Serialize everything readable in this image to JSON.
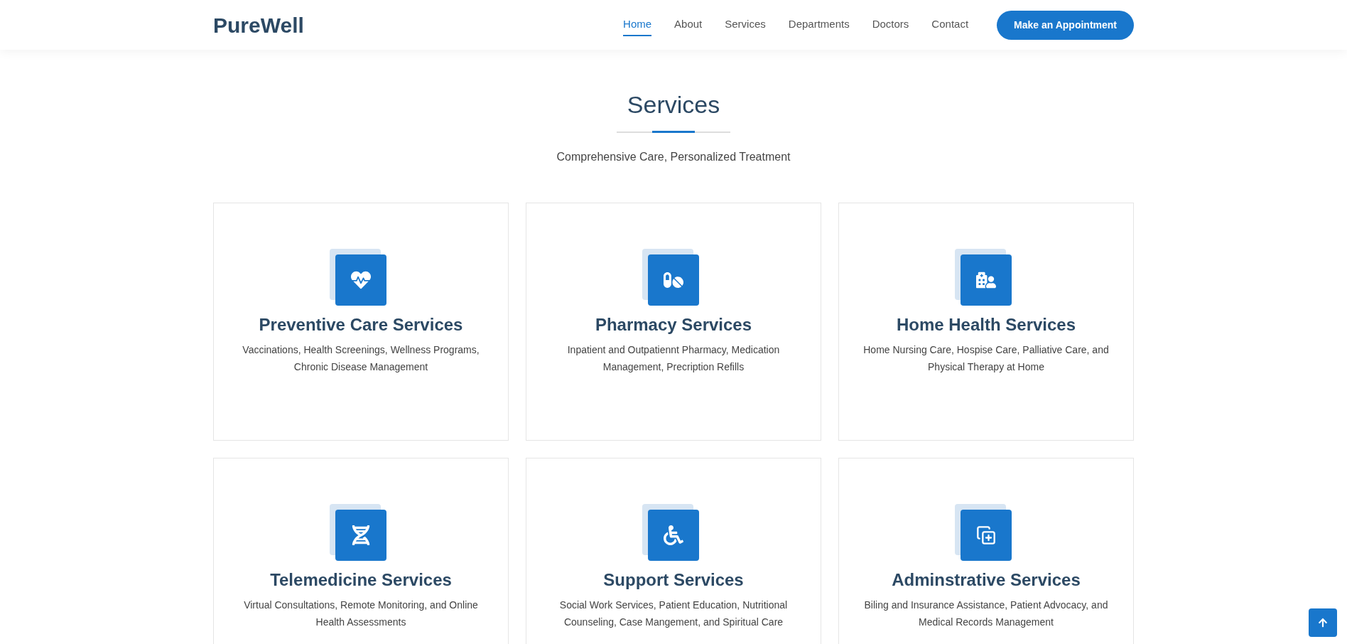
{
  "header": {
    "logo": "PureWell",
    "nav": [
      {
        "label": "Home",
        "selected": true
      },
      {
        "label": "About",
        "selected": false
      },
      {
        "label": "Services",
        "selected": false
      },
      {
        "label": "Departments",
        "selected": false
      },
      {
        "label": "Doctors",
        "selected": false
      },
      {
        "label": "Contact",
        "selected": false
      }
    ],
    "cta": "Make an Appointment"
  },
  "section": {
    "title": "Services",
    "subtitle": "Comprehensive Care, Personalized Treatment",
    "cards": [
      {
        "title": "Preventive Care Services",
        "text": "Vaccinations, Health Screenings, Wellness Programs, Chronic Disease Management"
      },
      {
        "title": "Pharmacy Services",
        "text": "Inpatient and Outpatiennt Pharmacy, Medication Management, Precription Refills"
      },
      {
        "title": "Home Health Services",
        "text": "Home Nursing Care, Hospise Care, Palliative Care, and Physical Therapy at Home"
      },
      {
        "title": "Telemedicine Services",
        "text": "Virtual Consultations, Remote Monitoring, and Online Health Assessments"
      },
      {
        "title": "Support Services",
        "text": "Social Work Services, Patient Education, Nutritional Counseling, Case Mangement, and Spiritual Care"
      },
      {
        "title": "Adminstrative Services",
        "text": "Biling and Insurance Assistance, Patient Advocacy, and Medical Records Management"
      }
    ]
  }
}
